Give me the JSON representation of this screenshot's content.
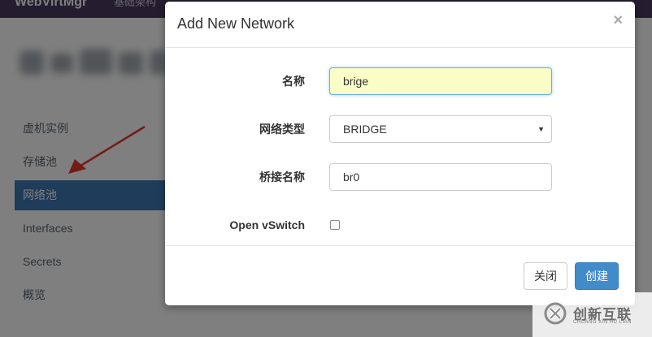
{
  "background": {
    "brand": "WebVirtMgr",
    "nav_fragment": "基础架构",
    "sidebar_items": [
      {
        "label": "虚机实例",
        "active": false
      },
      {
        "label": "存储池",
        "active": false
      },
      {
        "label": "网络池",
        "active": true
      },
      {
        "label": "Interfaces",
        "active": false
      },
      {
        "label": "Secrets",
        "active": false
      },
      {
        "label": "概览",
        "active": false
      }
    ]
  },
  "modal": {
    "title": "Add New Network",
    "close_glyph": "×",
    "fields": {
      "name": {
        "label": "名称",
        "value": "brige"
      },
      "type": {
        "label": "网络类型",
        "value": "BRIDGE"
      },
      "bridge_name": {
        "label": "桥接名称",
        "value": "br0"
      },
      "ovs": {
        "label": "Open vSwitch",
        "checked": false
      }
    },
    "buttons": {
      "close": "关闭",
      "create": "创建"
    }
  },
  "watermark": {
    "text_cn": "创新互联",
    "text_en": "CHUANG XIN HU LIAN"
  },
  "colors": {
    "topbar": "#4b3a5e",
    "sidebar_active": "#3f78b4",
    "primary_button": "#428bca",
    "focused_input": "#fafdc6",
    "arrow": "#e8372d"
  }
}
